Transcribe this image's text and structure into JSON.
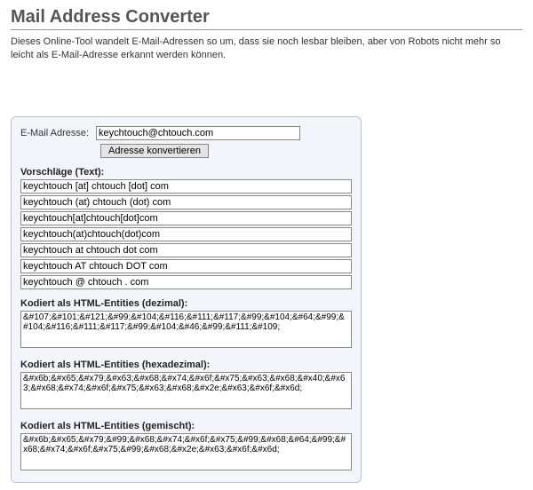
{
  "header": {
    "title": "Mail Address Converter",
    "intro": "Dieses Online-Tool wandelt E-Mail-Adressen so um, dass sie noch lesbar bleiben, aber von Robots nicht mehr so leicht als E-Mail-Adresse erkannt werden können."
  },
  "form": {
    "email_label": "E-Mail Adresse:",
    "email_value": "keychtouch@chtouch.com",
    "convert_label": "Adresse konvertieren"
  },
  "suggestions": {
    "title": "Vorschläge (Text):",
    "items": [
      "keychtouch [at] chtouch [dot] com",
      "keychtouch (at) chtouch (dot) com",
      "keychtouch[at]chtouch[dot]com",
      "keychtouch(at)chtouch(dot)com",
      "keychtouch at chtouch dot com",
      "keychtouch AT chtouch DOT com",
      "keychtouch @ chtouch . com"
    ]
  },
  "encoded_decimal": {
    "title": "Kodiert als HTML-Entities (dezimal):",
    "value": "&#107;&#101;&#121;&#99;&#104;&#116;&#111;&#117;&#99;&#104;&#64;&#99;&#104;&#116;&#111;&#117;&#99;&#104;&#46;&#99;&#111;&#109;"
  },
  "encoded_hex": {
    "title": "Kodiert als HTML-Entities (hexadezimal):",
    "value": "&#x6b;&#x65;&#x79;&#x63;&#x68;&#x74;&#x6f;&#x75;&#x63;&#x68;&#x40;&#x63;&#x68;&#x74;&#x6f;&#x75;&#x63;&#x68;&#x2e;&#x63;&#x6f;&#x6d;"
  },
  "encoded_mixed": {
    "title": "Kodiert als HTML-Entities (gemischt):",
    "value": "&#x6b;&#x65;&#x79;&#99;&#x68;&#x74;&#x6f;&#x75;&#99;&#x68;&#64;&#99;&#x68;&#x74;&#x6f;&#x75;&#99;&#x68;&#x2e;&#x63;&#x6f;&#x6d;"
  }
}
